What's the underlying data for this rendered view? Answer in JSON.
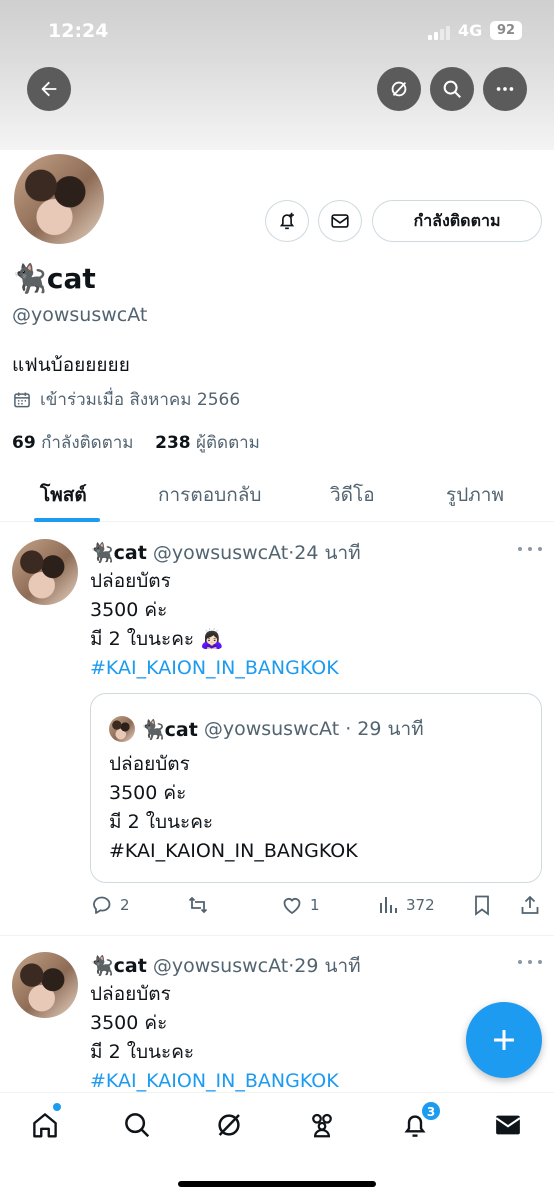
{
  "status_bar": {
    "time": "12:24",
    "network": "4G",
    "battery": "92"
  },
  "profile": {
    "display_name": "🐈‍⬛cat",
    "handle": "@yowsuswcAt",
    "bio": "แฟนบ้อยยยยย",
    "joined": "เข้าร่วมเมื่อ สิงหาคม 2566",
    "following_count": "69",
    "following_label": "กำลังติดตาม",
    "followers_count": "238",
    "followers_label": "ผู้ติดตาม",
    "follow_button": "กำลังติดตาม"
  },
  "tabs": [
    {
      "label": "โพสต์",
      "active": true
    },
    {
      "label": "การตอบกลับ"
    },
    {
      "label": "วิดีโอ"
    },
    {
      "label": "รูปภาพ"
    }
  ],
  "tweets": [
    {
      "name": "🐈‍⬛cat",
      "handle": "@yowsuswcAt",
      "time": "24 นาที",
      "lines": [
        "ปล่อยบัตร",
        "3500 ค่ะ",
        "มี 2 ใบนะคะ 🙇🏻‍♀️"
      ],
      "hashtag": "#KAI_KAION_IN_BANGKOK",
      "quote": {
        "name": "🐈‍⬛cat",
        "handle": "@yowsuswcAt",
        "time": "29 นาที",
        "lines": [
          "ปล่อยบัตร",
          "3500 ค่ะ",
          "มี 2 ใบนะคะ",
          "#KAI_KAION_IN_BANGKOK"
        ]
      },
      "replies": "2",
      "retweets": "",
      "likes": "1",
      "views": "372"
    },
    {
      "name": "🐈‍⬛cat",
      "handle": "@yowsuswcAt",
      "time": "29 นาที",
      "lines": [
        "ปล่อยบัตร",
        "3500 ค่ะ",
        "มี 2 ใบนะคะ"
      ],
      "hashtag": "#KAI_KAION_IN_BANGKOK"
    }
  ],
  "bottom_nav": {
    "notifications_badge": "3"
  },
  "colors": {
    "accent": "#1d9bf0",
    "text": "#0f1419",
    "muted": "#536471"
  }
}
